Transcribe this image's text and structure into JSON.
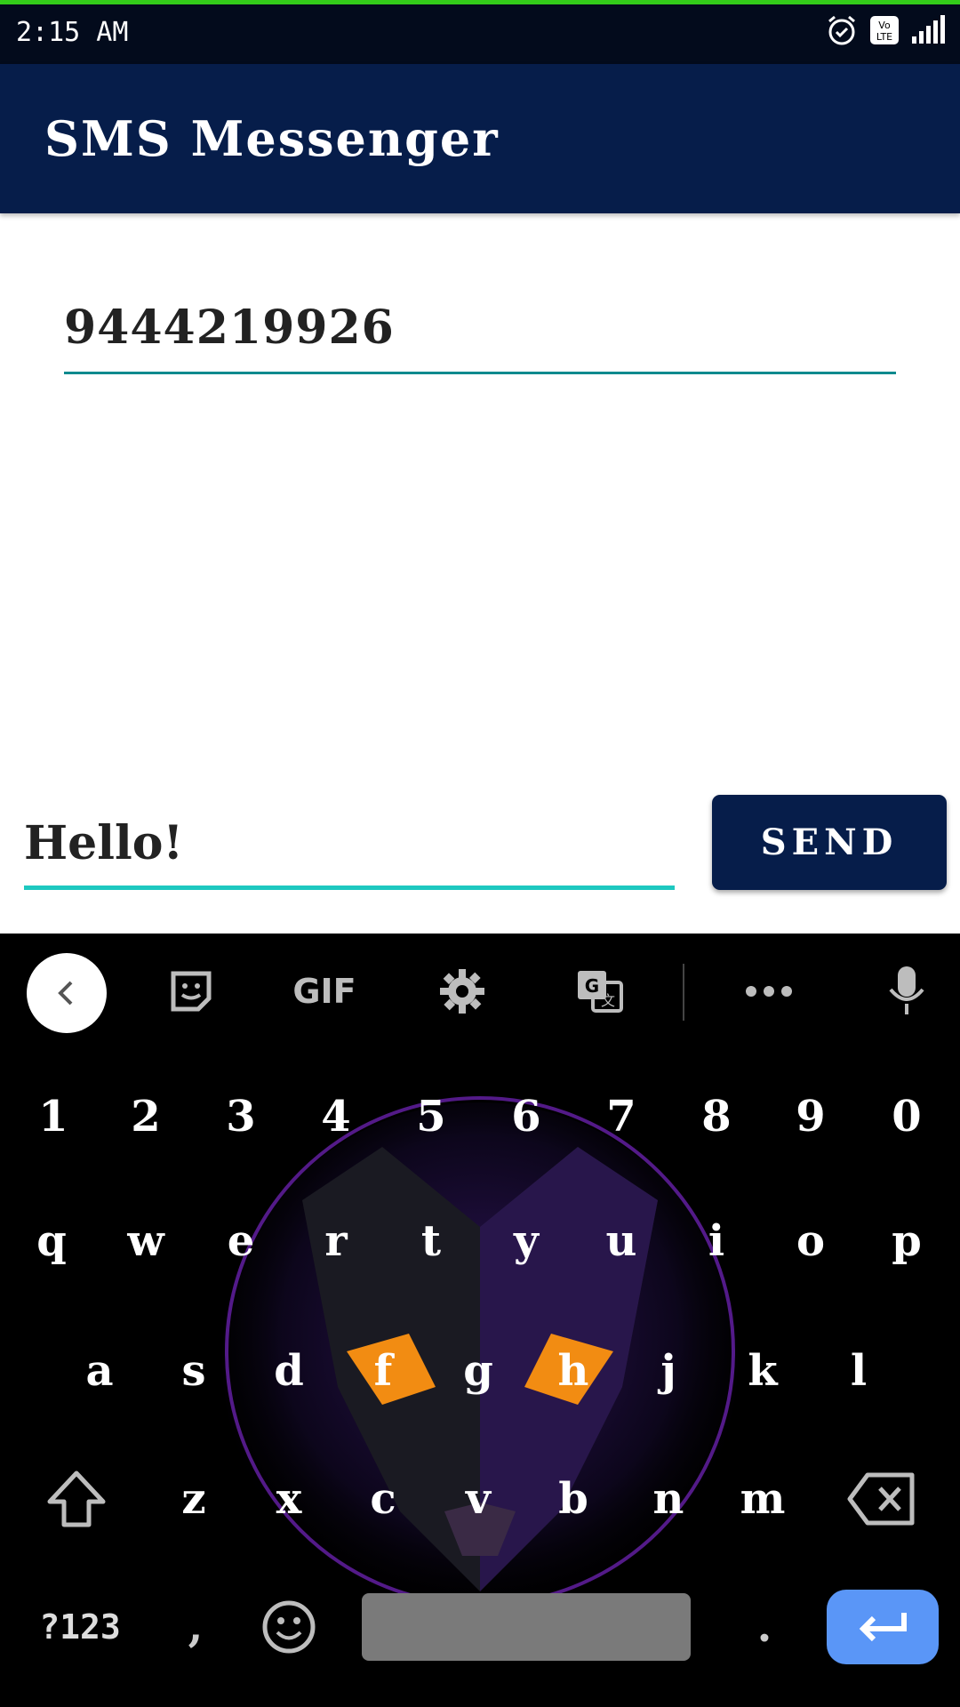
{
  "status_bar": {
    "time": "2:15 AM",
    "icons": [
      "alarm-icon",
      "volte-icon",
      "signal-icon"
    ]
  },
  "app_bar": {
    "title": "SMS Messenger"
  },
  "form": {
    "phone_number": "9444219926",
    "message": "Hello!",
    "send_label": "SEND"
  },
  "keyboard": {
    "toolbar": [
      "back-icon",
      "sticker-icon",
      "GIF",
      "settings-icon",
      "translate-icon",
      "more-icon",
      "mic-icon"
    ],
    "gif_label": "GIF",
    "number_row": [
      "1",
      "2",
      "3",
      "4",
      "5",
      "6",
      "7",
      "8",
      "9",
      "0"
    ],
    "row1": [
      "q",
      "w",
      "e",
      "r",
      "t",
      "y",
      "u",
      "i",
      "o",
      "p"
    ],
    "row2": [
      "a",
      "s",
      "d",
      "f",
      "g",
      "h",
      "j",
      "k",
      "l"
    ],
    "row3": [
      "z",
      "x",
      "c",
      "v",
      "b",
      "n",
      "m"
    ],
    "symbols_label": "?123",
    "comma": ",",
    "period": ".",
    "colors": {
      "enter": "#5a96f7",
      "accent": "#1ec8c0",
      "appbar": "#061d4a"
    }
  }
}
